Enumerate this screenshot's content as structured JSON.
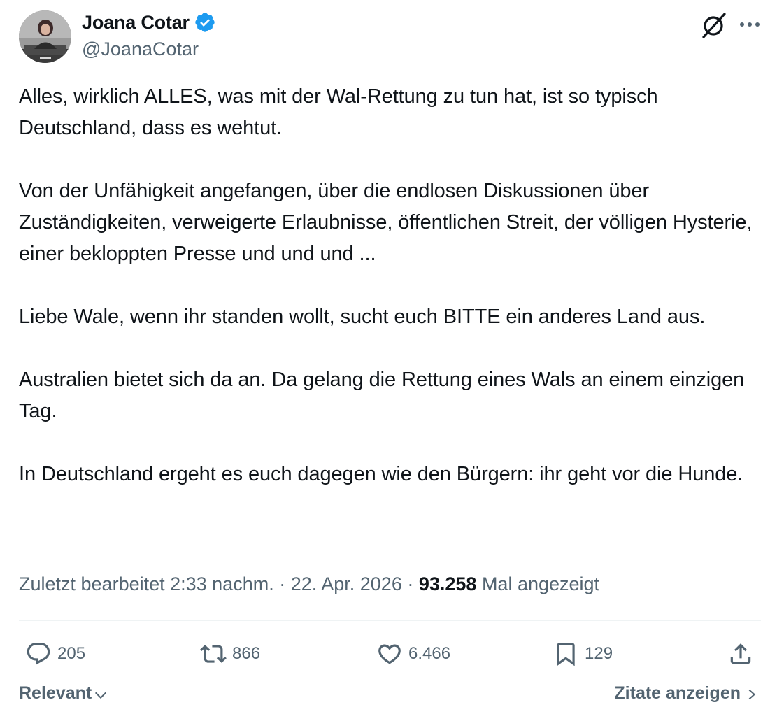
{
  "author": {
    "display_name": "Joana Cotar",
    "handle": "@JoanaCotar",
    "verified": true,
    "verified_color": "#1d9bf0"
  },
  "tweet": {
    "paragraphs": [
      "Alles, wirklich ALLES, was mit der Wal-Rettung zu tun hat, ist so typisch Deutschland, dass es wehtut.",
      "Von der Unfähigkeit angefangen, über die endlosen Diskussionen über Zuständigkeiten, verweigerte Erlaubnisse, öffentlichen Streit, der völligen Hysterie, einer bekloppten Presse und und und ...",
      "Liebe Wale, wenn ihr standen wollt, sucht euch BITTE ein anderes Land aus.",
      "Australien bietet sich da an. Da gelang die Rettung eines Wals an einem einzigen Tag.",
      "In Deutschland ergeht es euch dagegen wie den Bürgern: ihr geht vor die Hunde."
    ]
  },
  "meta": {
    "edited_time": "Zuletzt bearbeitet 2:33 nachm. · 22. Apr. 2026 · ",
    "views_count": "93.258",
    "views_label": " Mal angezeigt"
  },
  "actions": {
    "reply_count": "205",
    "repost_count": "866",
    "like_count": "6.466",
    "bookmark_count": "129"
  },
  "footer": {
    "sort_label": "Relevant",
    "quotes_label": "Zitate anzeigen"
  },
  "icons": {
    "grok": "grok-icon",
    "more": "more-icon",
    "reply": "reply-icon",
    "repost": "repost-icon",
    "like": "heart-icon",
    "bookmark": "bookmark-icon",
    "share": "share-icon",
    "sort": "chevron-down-icon",
    "quotes": "chevron-right-icon"
  },
  "colors": {
    "text_primary": "#0f1419",
    "text_secondary": "#536471",
    "divider": "#eff3f4"
  }
}
